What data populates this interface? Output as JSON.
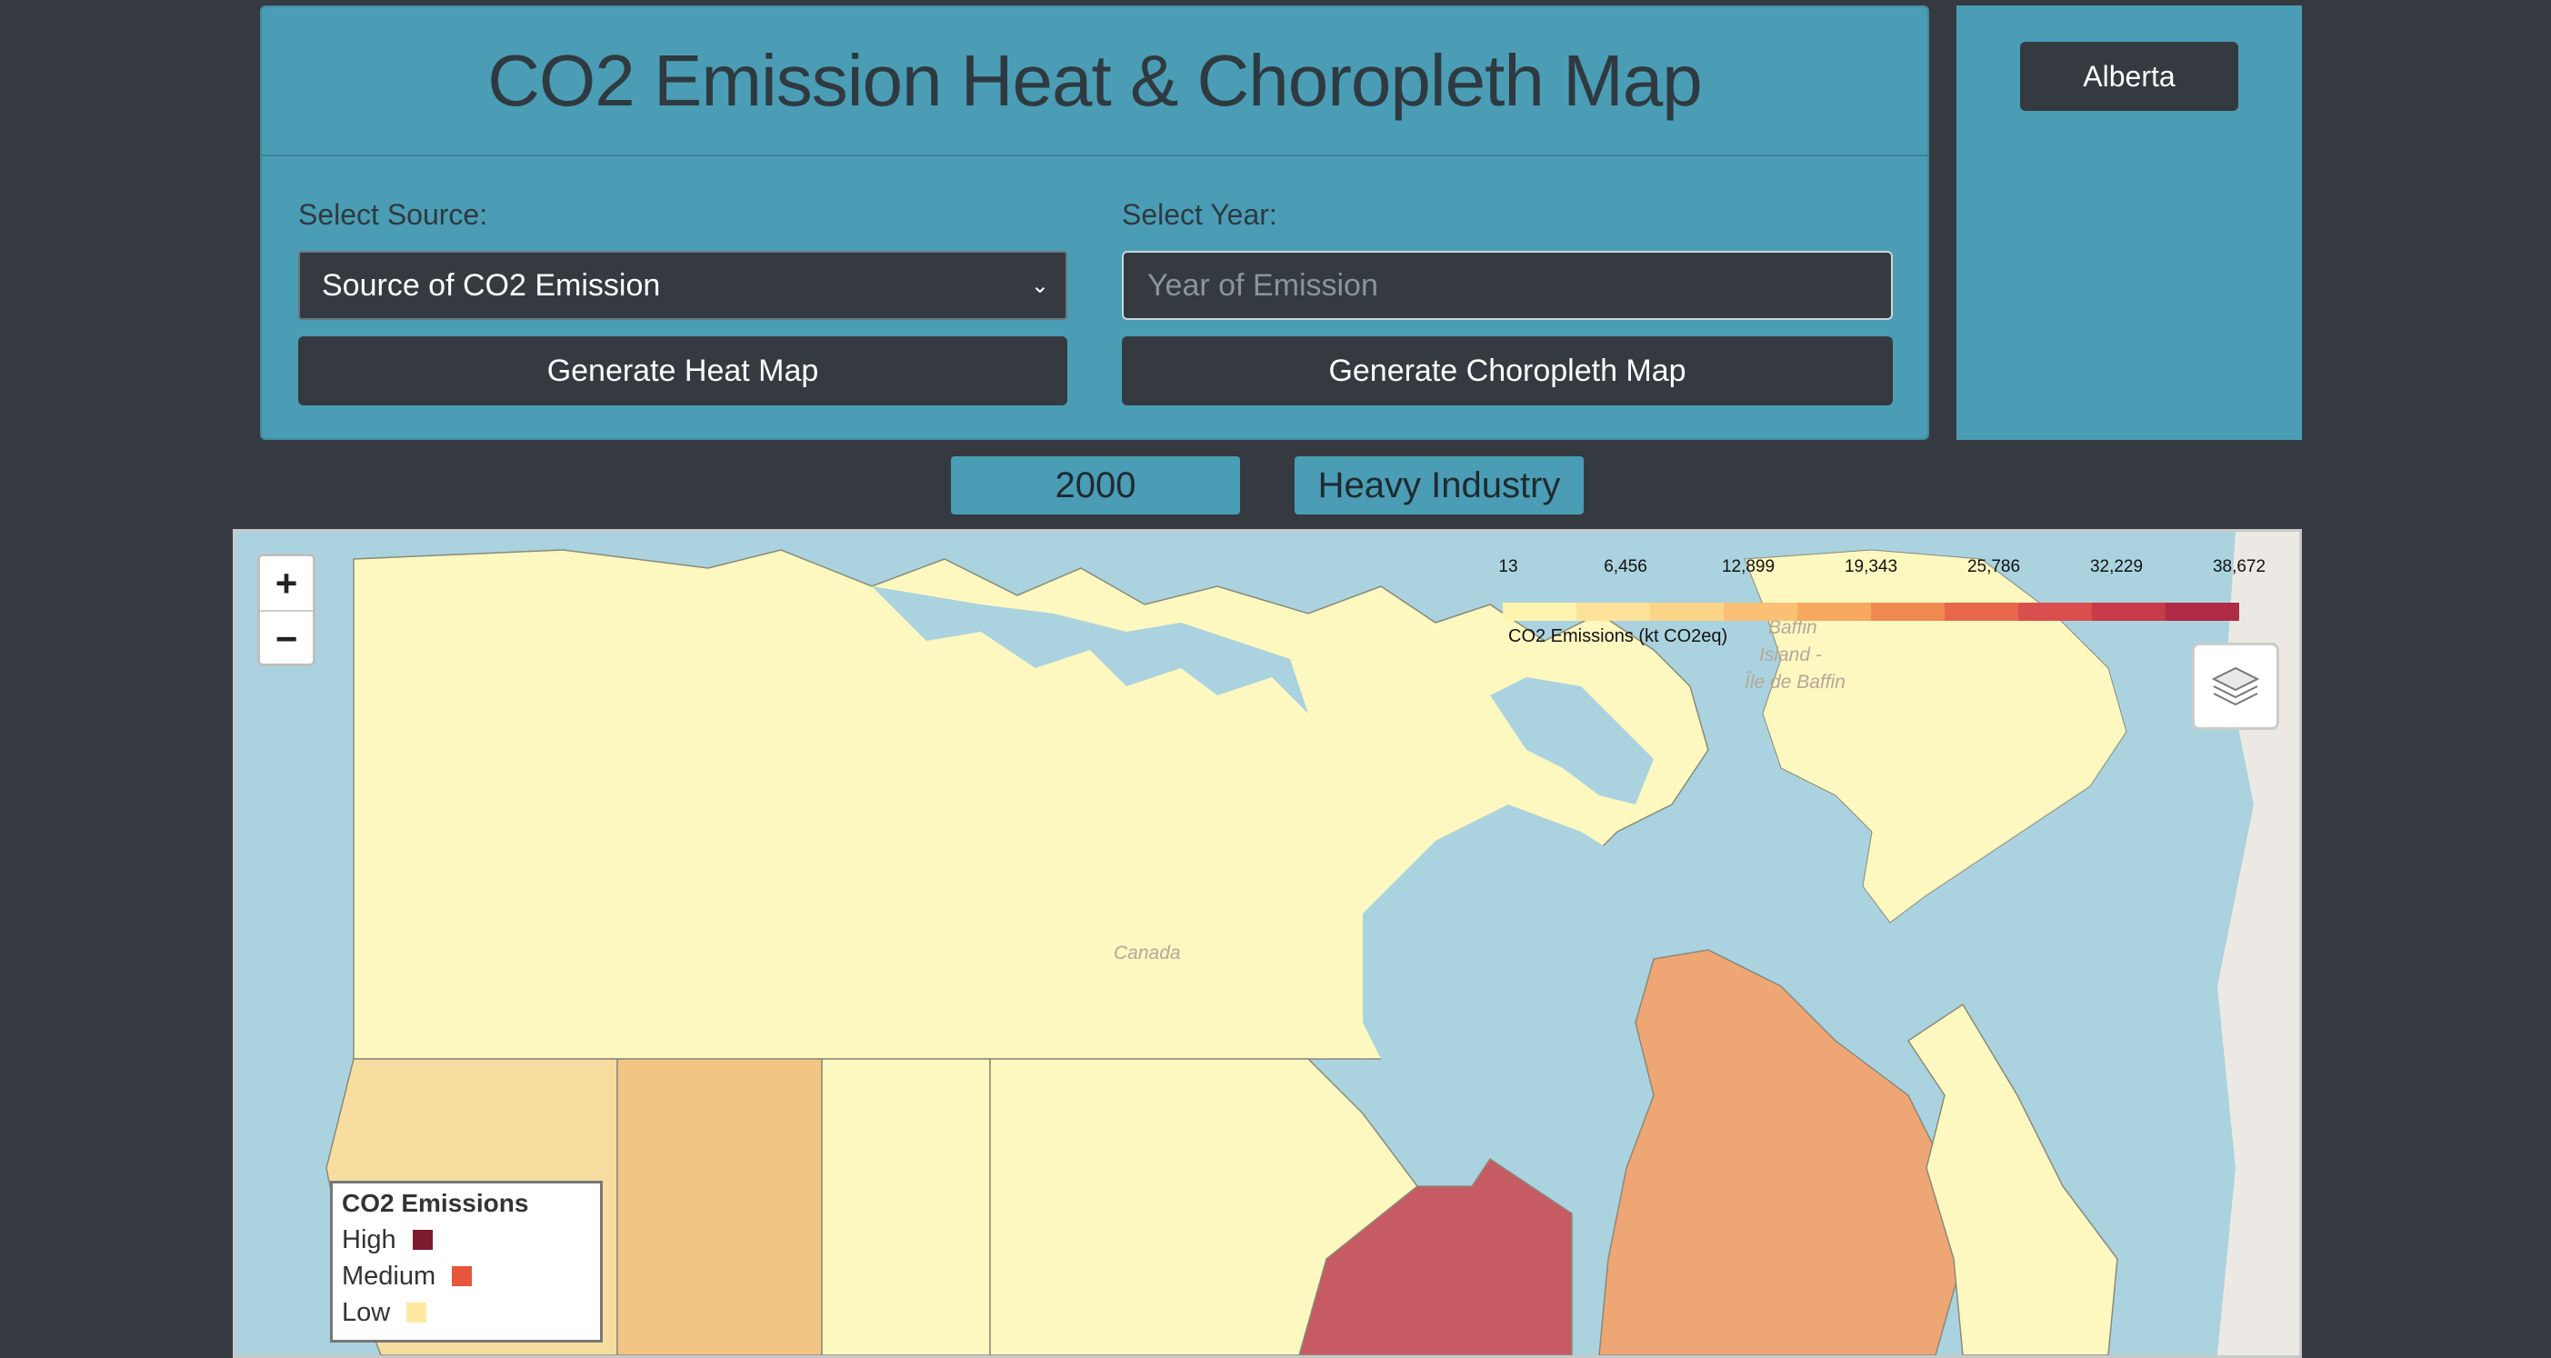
{
  "header": {
    "title": "CO2 Emission Heat & Choropleth Map"
  },
  "controls": {
    "source_label": "Select Source:",
    "source_selected": "Source of CO2 Emission",
    "year_label": "Select Year:",
    "year_placeholder": "Year of Emission",
    "heat_button": "Generate Heat Map",
    "choropleth_button": "Generate Choropleth Map"
  },
  "sidebar": {
    "province_button": "Alberta"
  },
  "filters": {
    "year": "2000",
    "source": "Heavy Industry"
  },
  "map": {
    "zoom_in": "+",
    "zoom_out": "−",
    "layers_icon": "layers-icon",
    "basemap_labels": {
      "country": "Canada",
      "island_en": "Baffin",
      "island_fr": "Island -",
      "island_fr2": "Île de Baffin"
    },
    "colorbar": {
      "ticks": [
        "13",
        "6,456",
        "12,899",
        "19,343",
        "25,786",
        "32,229",
        "38,672"
      ],
      "caption": "CO2 Emissions (kt CO2eq)",
      "colors": [
        "#fff3b0",
        "#fde39a",
        "#fcd487",
        "#fbc075",
        "#f7a85f",
        "#f08a50",
        "#e6674a",
        "#d84f4d",
        "#c63a4a",
        "#b02a45"
      ]
    },
    "legend": {
      "title": "CO2 Emissions",
      "items": [
        {
          "label": "High",
          "color": "#7d1a2e"
        },
        {
          "label": "Medium",
          "color": "#e8563a"
        },
        {
          "label": "Low",
          "color": "#fde9a2"
        }
      ]
    },
    "region_colors": {
      "low": "#fdf7c0",
      "bc": "#f7dea0",
      "alberta": "#f2c585",
      "ontario": "#c65b63",
      "quebec": "#eea674",
      "water": "#aad3df"
    }
  }
}
